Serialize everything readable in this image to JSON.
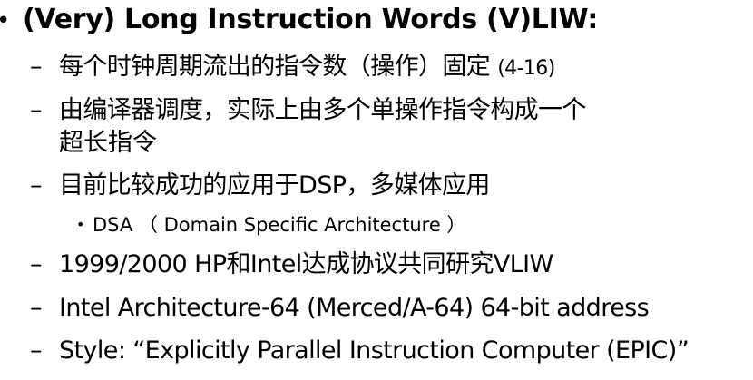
{
  "slide": {
    "heading": "(Very) Long Instruction Words (V)LIW:",
    "items": [
      {
        "text": "每个时钟周期流出的指令数（操作）固定",
        "note": "(4-16)"
      },
      {
        "text": "由编译器调度，实际上由多个单操作指令构成一个",
        "text2": "超长指令"
      },
      {
        "text": "目前比较成功的应用于DSP，多媒体应用"
      },
      {
        "text": "1999/2000 HP和Intel达成协议共同研究VLIW"
      },
      {
        "text": "Intel Architecture-64 (Merced/A-64) 64-bit address"
      },
      {
        "text": "Style: “Explicitly Parallel Instruction Computer (EPIC)”"
      }
    ],
    "subitem": {
      "text": "DSA （ Domain Specific Architecture ）"
    }
  }
}
